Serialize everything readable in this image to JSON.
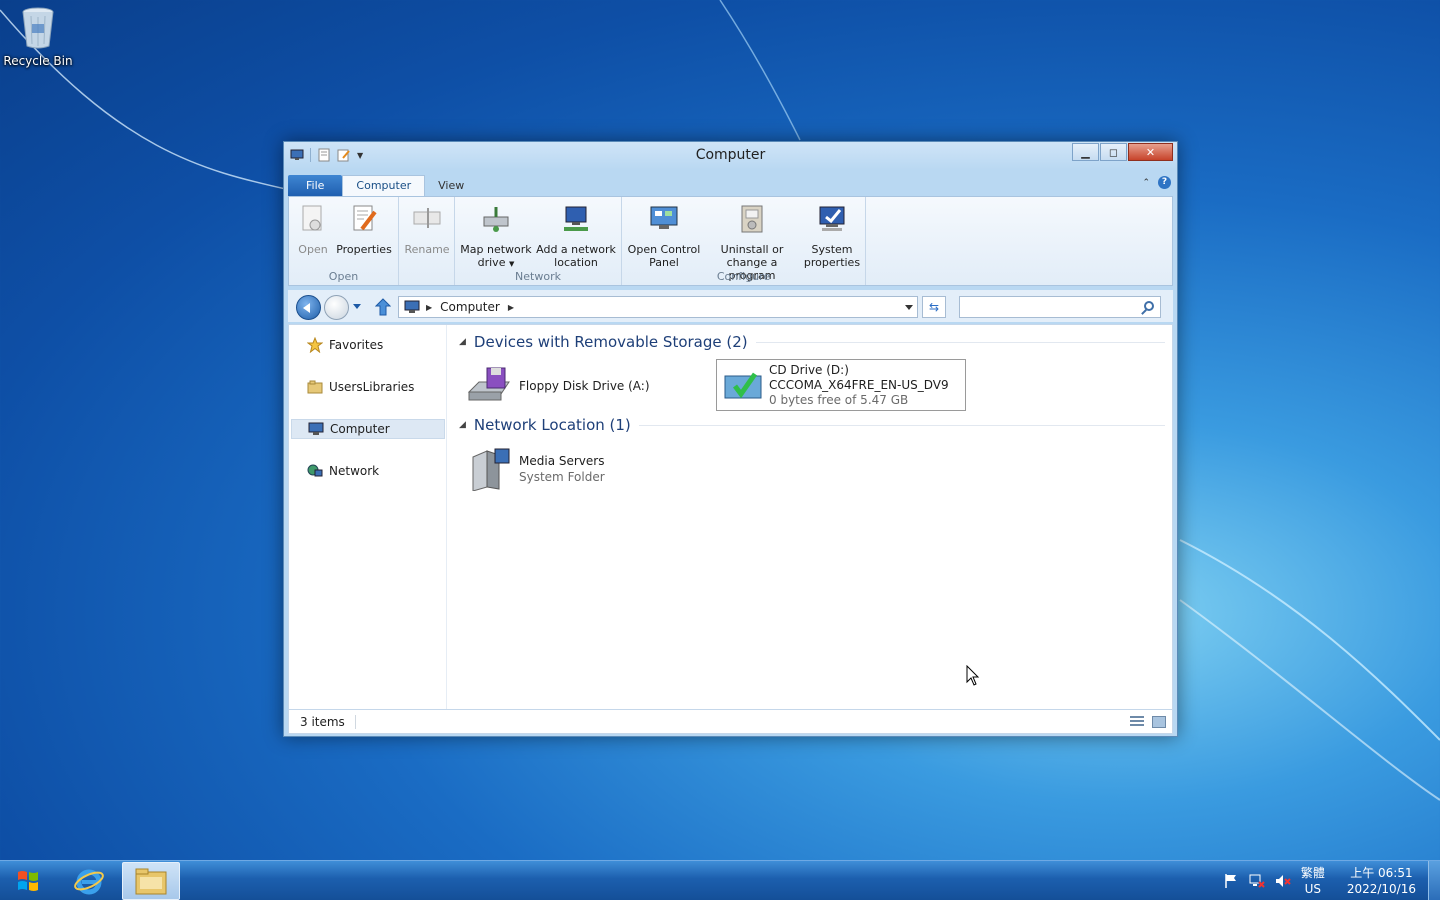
{
  "desktop": {
    "recycle_bin_label": "Recycle Bin"
  },
  "window": {
    "title": "Computer",
    "controls": {
      "minimize": "▁",
      "maximize": "◻",
      "close": "✕"
    }
  },
  "ribbon": {
    "tabs": [
      {
        "label": "File"
      },
      {
        "label": "Computer"
      },
      {
        "label": "View"
      }
    ],
    "groups": {
      "open": {
        "label": "Open",
        "buttons": [
          {
            "label": "Open",
            "icon": "open-icon"
          },
          {
            "label": "Properties",
            "icon": "properties-icon"
          }
        ]
      },
      "rename": {
        "label": "Rename",
        "icon": "rename-icon"
      },
      "network": {
        "label": "Network",
        "buttons": [
          {
            "line1": "Map network",
            "line2": "drive",
            "icon": "map-drive-icon"
          },
          {
            "line1": "Add a network",
            "line2": "location",
            "icon": "add-network-location-icon"
          }
        ]
      },
      "configure": {
        "label": "Configure",
        "buttons": [
          {
            "line1": "Open Control",
            "line2": "Panel",
            "icon": "control-panel-icon"
          },
          {
            "line1": "Uninstall or",
            "line2": "change a program",
            "icon": "uninstall-icon"
          },
          {
            "line1": "System",
            "line2": "properties",
            "icon": "system-properties-icon"
          }
        ]
      }
    }
  },
  "address": {
    "crumb": "Computer",
    "search_placeholder": ""
  },
  "navpane": {
    "items": [
      {
        "label": "Favorites",
        "icon": "star-icon"
      },
      {
        "label": "UsersLibraries",
        "icon": "libraries-icon"
      },
      {
        "label": "Computer",
        "icon": "computer-icon"
      },
      {
        "label": "Network",
        "icon": "network-icon"
      }
    ]
  },
  "content": {
    "groups": [
      {
        "header": "Devices with Removable Storage (2)",
        "items": [
          {
            "name": "Floppy Disk Drive (A:)",
            "icon": "floppy-drive-icon"
          },
          {
            "name": "CD Drive (D:)",
            "label": "CCCOMA_X64FRE_EN-US_DV9",
            "detail": "0 bytes free of 5.47 GB",
            "icon": "cd-drive-icon"
          }
        ]
      },
      {
        "header": "Network Location (1)",
        "items": [
          {
            "name": "Media Servers",
            "detail": "System Folder",
            "icon": "media-server-icon"
          }
        ]
      }
    ]
  },
  "statusbar": {
    "count": "3 items"
  },
  "taskbar": {
    "tray": {
      "ime": "繁體",
      "lang": "US",
      "time": "上午 06:51",
      "date": "2022/10/16"
    }
  },
  "colors": {
    "accent": "#1f5fb0",
    "window_frame": "#b9d8f2",
    "close": "#c7432a"
  }
}
